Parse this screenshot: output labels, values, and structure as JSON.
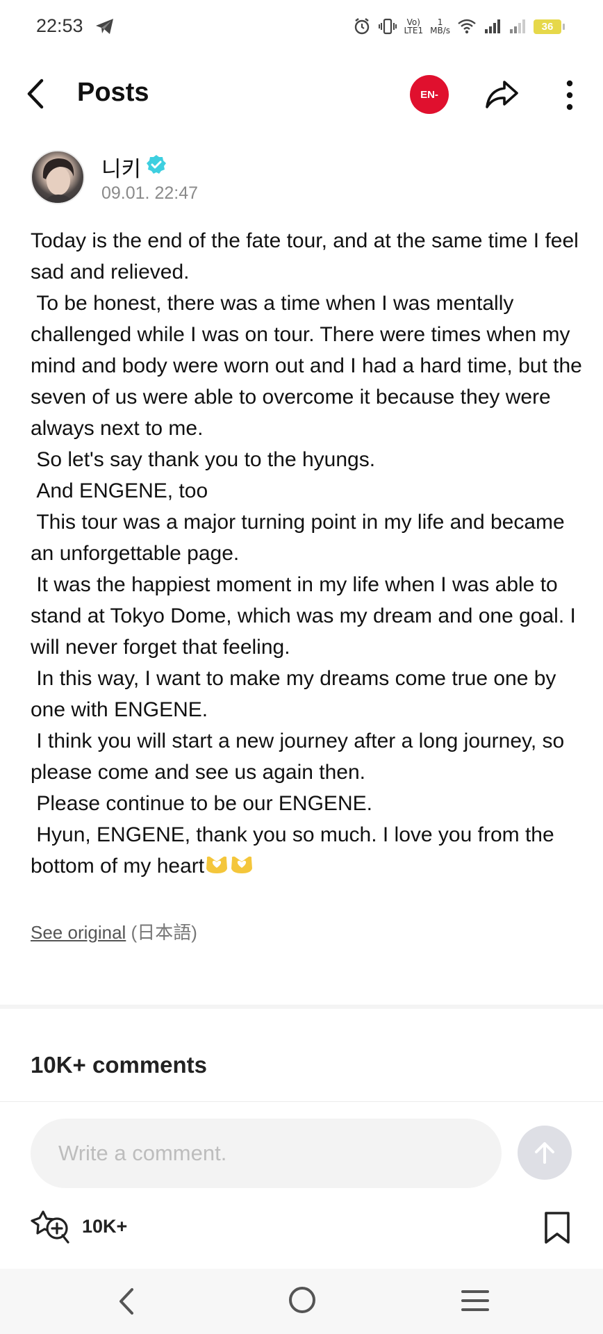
{
  "status_bar": {
    "time": "22:53",
    "network_speed_value": "1",
    "network_speed_unit": "MB/s",
    "volte_label": "Vo)",
    "lte_label": "LTE1",
    "battery": "36",
    "icons": [
      "telegram-icon",
      "alarm-icon",
      "vibrate-icon",
      "volte-icon",
      "wifi-icon",
      "signal-icon",
      "signal-weak-icon",
      "battery-icon"
    ]
  },
  "header": {
    "title": "Posts",
    "group_logo": "EN-",
    "icons": [
      "back-arrow-icon",
      "share-icon",
      "more-vertical-icon"
    ]
  },
  "author": {
    "name": "니키",
    "timestamp": "09.01. 22:47",
    "verified_color": "#3ecfe0"
  },
  "post": {
    "body": "Today is the end of the fate tour, and at the same time I feel sad and relieved.\n To be honest, there was a time when I was mentally challenged while I was on tour. There were times when my mind and body were worn out and I had a hard time, but the seven of us were able to overcome it because they were always next to me.\n So let's say thank you to the hyungs.\n And ENGENE, too\n This tour was a major turning point in my life and became an unforgettable page.\n It was the happiest moment in my life when I was able to stand at Tokyo Dome, which was my dream and one goal. I will never forget that feeling.\n In this way, I want to make my dreams come true one by one with ENGENE.\n I think you will start a new journey after a long journey, so please come and see us again then.\n Please continue to be our ENGENE.\n Hyun, ENGENE, thank you so much. I love you from the bottom of my heart",
    "trailing_emoji": "heart-hands-emoji x2",
    "see_original_label": "See original",
    "original_language": "(日本語)"
  },
  "comments": {
    "count_label": "10K+ comments",
    "input_placeholder": "Write a comment."
  },
  "actions": {
    "reaction_count": "10K+",
    "icons": [
      "reaction-add-icon",
      "bookmark-icon",
      "send-arrow-icon"
    ]
  },
  "nav_bar": {
    "icons": [
      "nav-back-icon",
      "nav-home-icon",
      "nav-menu-icon"
    ]
  },
  "colors": {
    "brand_red": "#e0102e",
    "verified": "#3ecfe0",
    "battery": "#e6d84a",
    "send_button_bg": "#dedfe5",
    "input_bg": "#f3f3f3"
  }
}
